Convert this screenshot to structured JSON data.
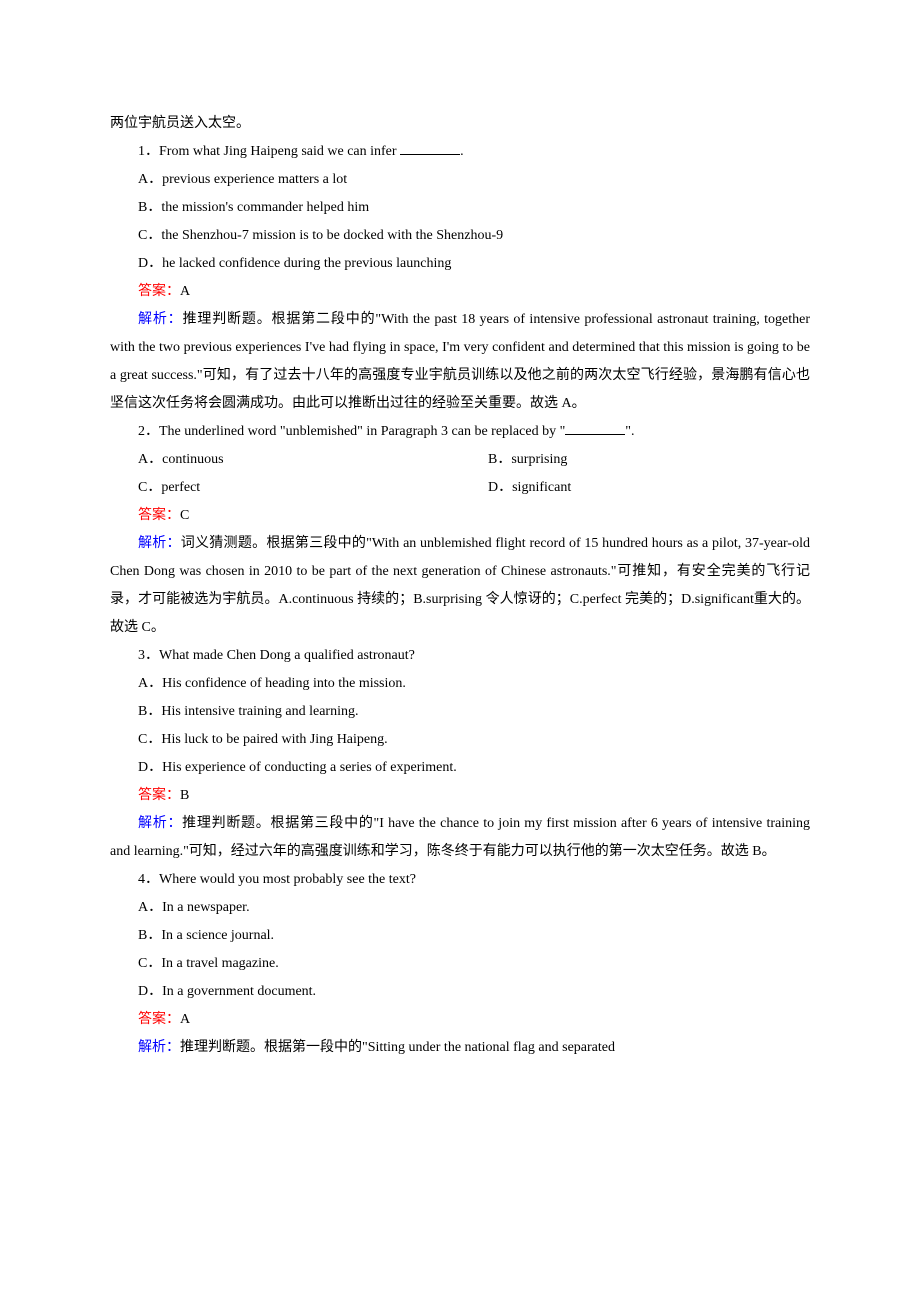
{
  "intro": "两位宇航员送入太空。",
  "q1": {
    "stem_a": "1．From what Jing Haipeng said we can infer ",
    "stem_b": ".",
    "optA": "A．previous experience matters a lot",
    "optB": "B．the mission's commander helped him",
    "optC": "C．the Shenzhou-7 mission is to be docked with the Shenzhou-9",
    "optD": "D．he lacked confidence during the previous launching",
    "ans_label": "答案：",
    "ans_val": "A",
    "exp_label": "解析：",
    "exp_text": "推理判断题。根据第二段中的\"With the past 18 years of intensive professional astronaut training, together with the two previous experiences I've had flying in space, I'm very confident and determined that this mission is going to be a great success.\"可知，有了过去十八年的高强度专业宇航员训练以及他之前的两次太空飞行经验，景海鹏有信心也坚信这次任务将会圆满成功。由此可以推断出过往的经验至关重要。故选 A。"
  },
  "q2": {
    "stem_a": "2．The underlined word \"unblemished\" in Paragraph 3 can be replaced by \"",
    "stem_b": "\".",
    "optA": "A．continuous",
    "optB": "B．surprising",
    "optC": "C．perfect",
    "optD": "D．significant",
    "ans_label": "答案：",
    "ans_val": "C",
    "exp_label": "解析：",
    "exp_text": "词义猜测题。根据第三段中的\"With an unblemished flight record of 15 hundred hours as a pilot, 37-year-old Chen Dong was chosen in 2010 to be part of the next generation of Chinese astronauts.\"可推知，有安全完美的飞行记录，才可能被选为宇航员。A.continuous 持续的；B.surprising 令人惊讶的；C.perfect 完美的；D.significant重大的。故选 C。"
  },
  "q3": {
    "stem": "3．What made Chen Dong a qualified astronaut?",
    "optA": "A．His confidence of heading into the mission.",
    "optB": "B．His intensive training and learning.",
    "optC": "C．His luck to be paired with Jing Haipeng.",
    "optD": "D．His experience of conducting a series of experiment.",
    "ans_label": "答案：",
    "ans_val": "B",
    "exp_label": "解析：",
    "exp_text": "推理判断题。根据第三段中的\"I have the chance to join my first mission after 6 years of intensive training and learning.\"可知，经过六年的高强度训练和学习，陈冬终于有能力可以执行他的第一次太空任务。故选 B。"
  },
  "q4": {
    "stem": "4．Where would you most probably see the text?",
    "optA": "A．In a newspaper.",
    "optB": "B．In a science journal.",
    "optC": "C．In a travel magazine.",
    "optD": "D．In a government document.",
    "ans_label": "答案：",
    "ans_val": "A",
    "exp_label": "解析：",
    "exp_text": "推理判断题。根据第一段中的\"Sitting under the national flag and separated"
  }
}
